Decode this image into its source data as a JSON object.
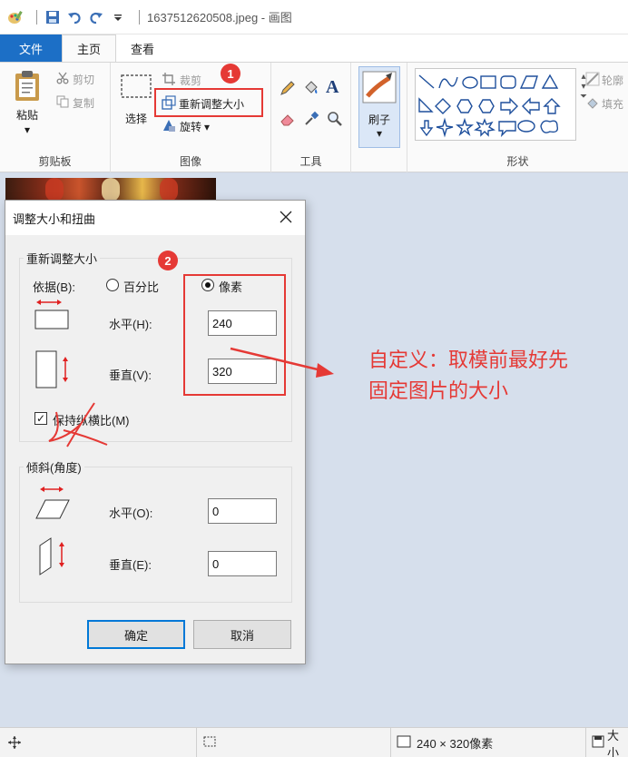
{
  "title": "1637512620508.jpeg - 画图",
  "tabs": {
    "file": "文件",
    "home": "主页",
    "view": "查看"
  },
  "clipboard": {
    "paste": "粘贴",
    "cut": "剪切",
    "copy": "复制",
    "label": "剪贴板"
  },
  "image": {
    "select": "选择",
    "crop": "裁剪",
    "resize": "重新调整大小",
    "rotate": "旋转",
    "label": "图像"
  },
  "tools": {
    "label": "工具"
  },
  "brushes": {
    "label": "刷子"
  },
  "shapes": {
    "label": "形状",
    "outline": "轮廓",
    "fill": "填充"
  },
  "dialog": {
    "title": "调整大小和扭曲",
    "resize_legend": "重新调整大小",
    "by_label": "依据(B):",
    "percent_label": "百分比",
    "pixels_label": "像素",
    "horizontal_label": "水平(H):",
    "vertical_label": "垂直(V):",
    "horizontal_value": "240",
    "vertical_value": "320",
    "keep_ratio_label": "保持纵横比(M)",
    "skew_legend": "倾斜(角度)",
    "skew_h_label": "水平(O):",
    "skew_v_label": "垂直(E):",
    "skew_h_value": "0",
    "skew_v_value": "0",
    "ok": "确定",
    "cancel": "取消"
  },
  "annotations": {
    "step1": "1",
    "step2": "2",
    "note_line1": "自定义：取模前最好先",
    "note_line2": "固定图片的大小",
    "color": "#e53935"
  },
  "status": {
    "dimensions": "240 × 320像素",
    "size_prefix": "大小"
  },
  "accent": "#1c6fc6"
}
